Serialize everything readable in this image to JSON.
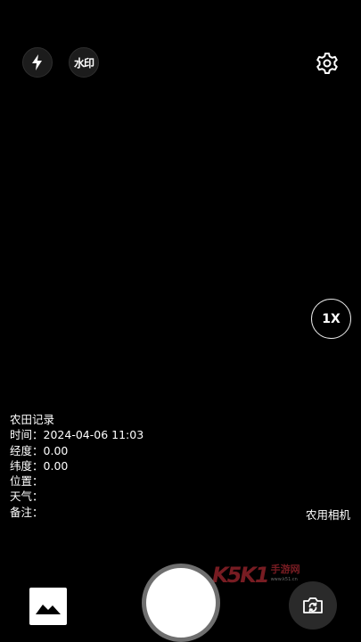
{
  "top_bar": {
    "flash_icon": "lightning-bolt",
    "watermark_label": "水印",
    "settings_icon": "gear"
  },
  "zoom": {
    "label": "1X"
  },
  "watermark": {
    "title": "农田记录",
    "time_label": "时间：",
    "time_value": "2024-04-06 11:03",
    "longitude_label": "经度：",
    "longitude_value": "0.00",
    "latitude_label": "纬度：",
    "latitude_value": "0.00",
    "location_label": "位置：",
    "location_value": "",
    "weather_label": "天气：",
    "weather_value": "",
    "note_label": "备注：",
    "note_value": ""
  },
  "app_tag": "农用相机",
  "site_logo": {
    "k5": "K5K1",
    "cn": "手游网",
    "url": "www.k51.cn"
  },
  "bottom_bar": {
    "gallery_icon": "image",
    "shutter": "capture",
    "switch_icon": "camera-rotate"
  },
  "colors": {
    "background": "#000000",
    "foreground": "#ffffff",
    "logo_red": "#d9333f"
  }
}
